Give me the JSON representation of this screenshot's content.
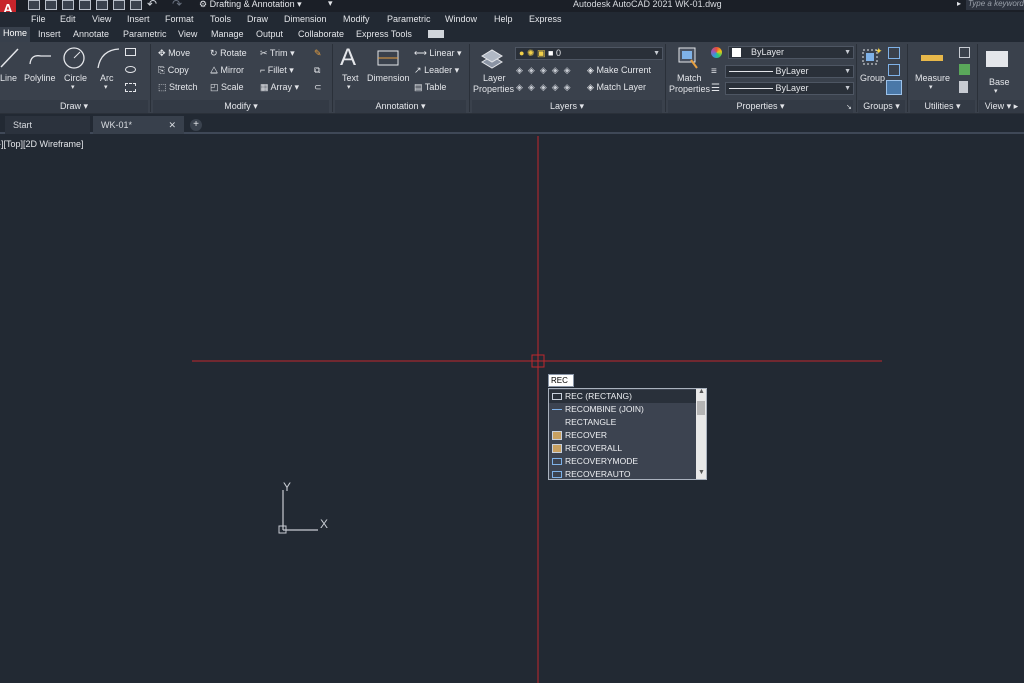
{
  "titlebar": {
    "workspace": "Drafting & Annotation",
    "app_title": "Autodesk AutoCAD 2021    WK-01.dwg",
    "search_placeholder": "Type a keyword"
  },
  "menu": [
    "File",
    "Edit",
    "View",
    "Insert",
    "Format",
    "Tools",
    "Draw",
    "Dimension",
    "Modify",
    "Parametric",
    "Window",
    "Help",
    "Express"
  ],
  "ribbon_tabs": [
    "Home",
    "Insert",
    "Annotate",
    "Parametric",
    "View",
    "Manage",
    "Output",
    "Collaborate",
    "Express Tools"
  ],
  "ribbon_active_tab": "Home",
  "draw_panel": {
    "title": "Draw",
    "line": "Line",
    "polyline": "Polyline",
    "circle": "Circle",
    "arc": "Arc"
  },
  "modify_panel": {
    "title": "Modify",
    "move": "Move",
    "copy": "Copy",
    "stretch": "Stretch",
    "rotate": "Rotate",
    "mirror": "Mirror",
    "scale": "Scale",
    "trim": "Trim",
    "fillet": "Fillet",
    "array": "Array"
  },
  "annotation_panel": {
    "title": "Annotation",
    "text": "Text",
    "dimension": "Dimension",
    "linear": "Linear",
    "leader": "Leader",
    "table": "Table"
  },
  "layers_panel": {
    "title": "Layers",
    "layer_properties_1": "Layer",
    "layer_properties_2": "Properties",
    "current_layer": "0",
    "make_current": "Make Current",
    "match_layer": "Match Layer"
  },
  "properties_panel": {
    "title": "Properties",
    "match_1": "Match",
    "match_2": "Properties",
    "color": "ByLayer",
    "linetype": "ByLayer",
    "lineweight": "ByLayer"
  },
  "groups_panel": {
    "title": "Groups",
    "group": "Group"
  },
  "utilities_panel": {
    "title": "Utilities",
    "measure": "Measure"
  },
  "view_panel": {
    "title": "View",
    "base": "Base"
  },
  "doc_tabs": {
    "start": "Start",
    "active": "WK-01*"
  },
  "viewport_label": "-][Top][2D Wireframe]",
  "command": {
    "input": "REC"
  },
  "autocomplete": [
    {
      "label": "REC (RECTANG)",
      "icon": "rectangle-icon"
    },
    {
      "label": "RECOMBINE (JOIN)",
      "icon": "join-icon"
    },
    {
      "label": "RECTANGLE",
      "icon": ""
    },
    {
      "label": "RECOVER",
      "icon": "recover-icon"
    },
    {
      "label": "RECOVERALL",
      "icon": "recover-icon"
    },
    {
      "label": "RECOVERYMODE",
      "icon": "sysvar-icon"
    },
    {
      "label": "RECOVERAUTO",
      "icon": "sysvar-icon"
    }
  ],
  "ucs": {
    "x": "X",
    "y": "Y"
  },
  "colors": {
    "crosshair": "#c0272d",
    "background": "#222933",
    "ribbon": "#3a414c"
  }
}
